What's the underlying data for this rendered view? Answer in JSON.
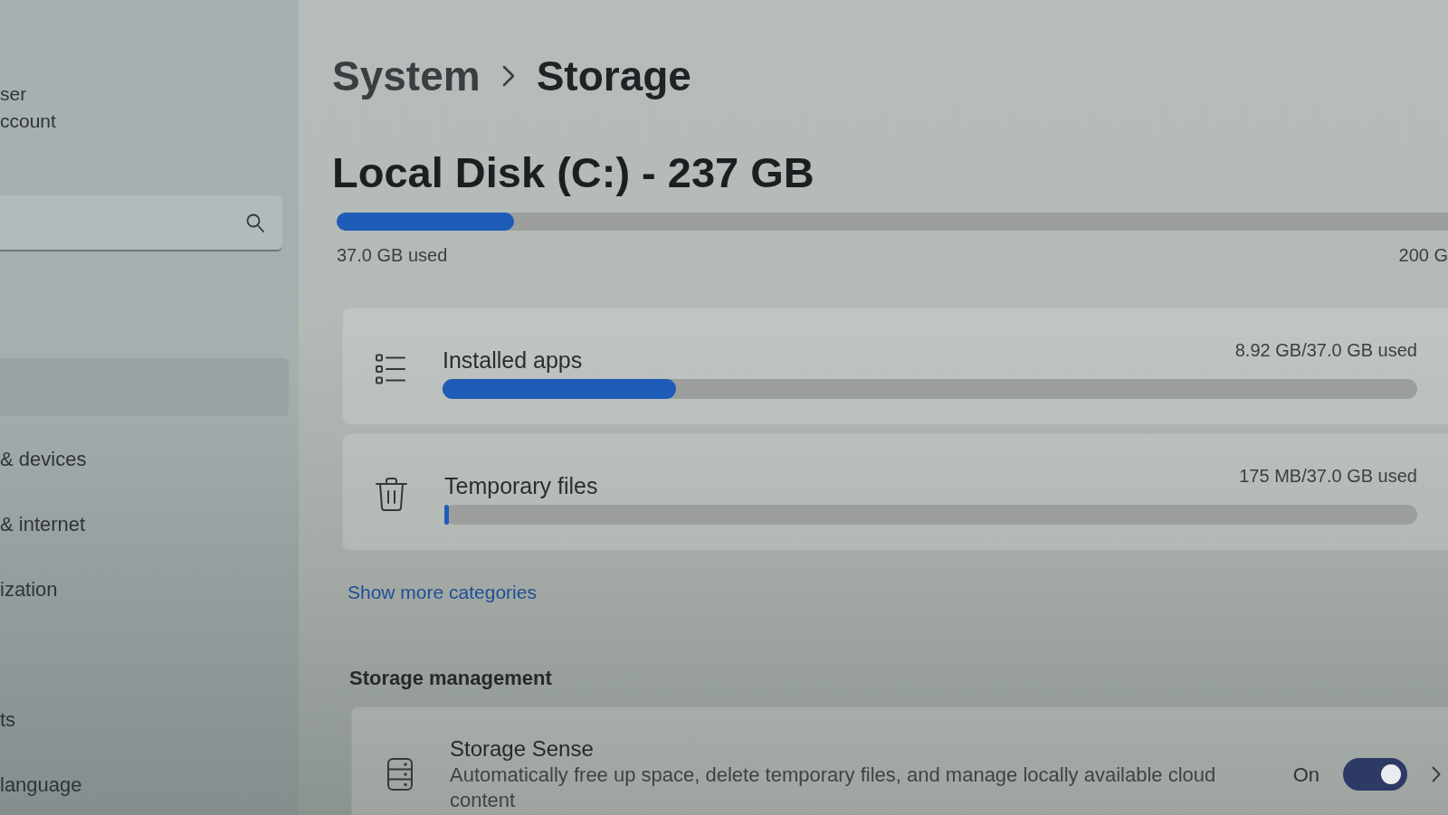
{
  "sidebar": {
    "user_name": "ser",
    "account_label": "ccount",
    "items": [
      {
        "selected": true
      },
      {
        "label": "& devices",
        "selected": false
      },
      {
        "label": "& internet",
        "selected": false
      },
      {
        "label": "ization",
        "selected": false
      },
      {
        "label": "ts",
        "selected": false
      },
      {
        "label": "language",
        "selected": false
      }
    ]
  },
  "breadcrumb": [
    "System",
    "Storage"
  ],
  "disk": {
    "title": "Local Disk (C:) - 237 GB",
    "level": 0.16,
    "used": "37.0 GB used",
    "free": "200 G"
  },
  "categories": [
    {
      "kind": "apps",
      "label": "Installed apps",
      "usage": "8.92 GB/37.0 GB used",
      "level": 0.24
    },
    {
      "kind": "temp",
      "label": "Temporary files",
      "usage": "175 MB/37.0 GB used",
      "level": 0.005
    }
  ],
  "show_more": "Show more categories",
  "management": {
    "heading": "Storage management",
    "items": [
      {
        "kind": "storage_sense",
        "title": "Storage Sense",
        "description": "Automatically free up space, delete temporary files, and manage locally available cloud content",
        "state_label": "On",
        "on": true
      }
    ]
  }
}
